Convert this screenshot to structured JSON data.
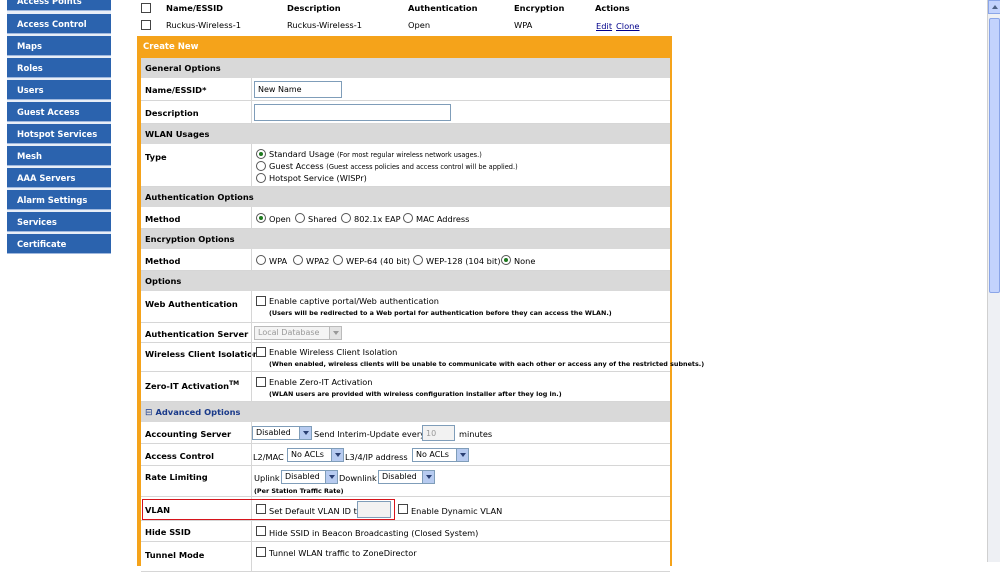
{
  "sidebar": {
    "items": [
      {
        "label": "Access Points"
      },
      {
        "label": "Access Control"
      },
      {
        "label": "Maps"
      },
      {
        "label": "Roles"
      },
      {
        "label": "Users"
      },
      {
        "label": "Guest Access"
      },
      {
        "label": "Hotspot Services"
      },
      {
        "label": "Mesh"
      },
      {
        "label": "AAA Servers"
      },
      {
        "label": "Alarm Settings"
      },
      {
        "label": "Services"
      },
      {
        "label": "Certificate"
      }
    ]
  },
  "table": {
    "headers": [
      "Name/ESSID",
      "Description",
      "Authentication",
      "Encryption",
      "Actions"
    ],
    "rows": [
      {
        "name": "Ruckus-Wireless-1",
        "description": "Ruckus-Wireless-1",
        "authentication": "Open",
        "encryption": "WPA",
        "edit": "Edit",
        "clone": "Clone"
      }
    ]
  },
  "create": {
    "title": "Create New",
    "general": {
      "header": "General Options",
      "name_label": "Name/ESSID*",
      "name_value": "New Name",
      "desc_label": "Description",
      "desc_value": ""
    },
    "usage": {
      "header": "WLAN Usages",
      "type_label": "Type",
      "options": [
        {
          "label": "Standard Usage",
          "note": "(For most regular wireless network usages.)",
          "selected": true
        },
        {
          "label": "Guest Access",
          "note": "(Guest access policies and access control will be applied.)",
          "selected": false
        },
        {
          "label": "Hotspot Service (WISPr)",
          "note": "",
          "selected": false
        }
      ]
    },
    "auth": {
      "header": "Authentication Options",
      "method_label": "Method",
      "options": [
        {
          "label": "Open",
          "selected": true
        },
        {
          "label": "Shared",
          "selected": false
        },
        {
          "label": "802.1x EAP",
          "selected": false
        },
        {
          "label": "MAC Address",
          "selected": false
        }
      ]
    },
    "enc": {
      "header": "Encryption Options",
      "method_label": "Method",
      "options": [
        {
          "label": "WPA",
          "selected": false
        },
        {
          "label": "WPA2",
          "selected": false
        },
        {
          "label": "WEP-64 (40 bit)",
          "selected": false
        },
        {
          "label": "WEP-128 (104 bit)",
          "selected": false
        },
        {
          "label": "None",
          "selected": true
        }
      ]
    },
    "options": {
      "header": "Options",
      "web_auth_label": "Web Authentication",
      "web_auth_check": "Enable captive portal/Web authentication",
      "web_auth_note": "(Users will be redirected to a Web portal for authentication before they can access the WLAN.)",
      "auth_server_label": "Authentication Server",
      "auth_server_value": "Local Database",
      "isolation_label": "Wireless Client Isolation",
      "isolation_check": "Enable Wireless Client Isolation",
      "isolation_note": "(When enabled, wireless clients will be unable to communicate with each other or access any of the restricted subnets.)",
      "zeroit_label": "Zero-IT Activation",
      "zeroit_sup": "TM",
      "zeroit_check": "Enable Zero-IT Activation",
      "zeroit_note": "(WLAN users are provided with wireless configuration installer after they log in.)"
    },
    "advanced": {
      "header": "Advanced Options",
      "toggle": "⊟",
      "acct_label": "Accounting Server",
      "acct_value": "Disabled",
      "interim_label": "Send Interim-Update every",
      "interim_value": "10",
      "interim_unit": "minutes",
      "ac_label": "Access Control",
      "l2_label": "L2/MAC",
      "l2_value": "No ACLs",
      "l34_label": "L3/4/IP address",
      "l34_value": "No ACLs",
      "rate_label": "Rate Limiting",
      "uplink_label": "Uplink",
      "uplink_value": "Disabled",
      "downlink_label": "Downlink",
      "downlink_value": "Disabled",
      "rate_note": "(Per Station Traffic Rate)",
      "vlan_label": "VLAN",
      "vlan_check": "Set Default VLAN ID to",
      "vlan_value": "",
      "dyn_vlan": "Enable Dynamic VLAN",
      "hide_label": "Hide SSID",
      "hide_check": "Hide SSID in Beacon Broadcasting (Closed System)",
      "tunnel_label": "Tunnel Mode",
      "tunnel_check": "Tunnel WLAN traffic to ZoneDirector"
    }
  },
  "colors": {
    "sidebar": "#2b63ae",
    "accent": "#f5a31a",
    "highlight": "#d6141c"
  }
}
